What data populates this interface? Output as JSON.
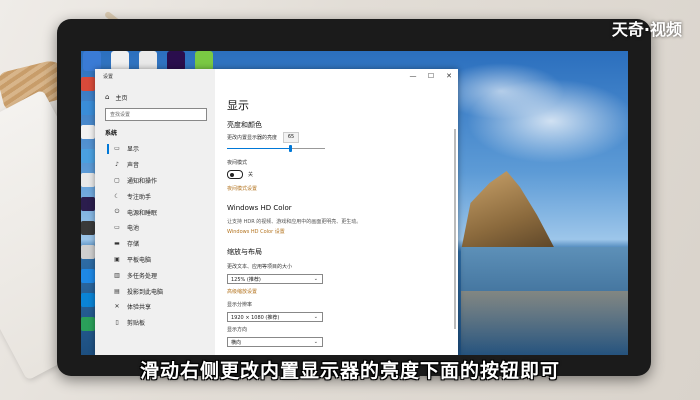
{
  "watermark": "天奇·视频",
  "subtitle": "滑动右侧更改内置显示器的亮度下面的按钮即可",
  "window": {
    "title": "设置",
    "minimize": "—",
    "maximize": "☐",
    "close": "✕"
  },
  "nav": {
    "home": "主页",
    "search_placeholder": "查找设置",
    "section": "系统",
    "items": [
      {
        "icon": "display-icon",
        "glyph": "▭",
        "label": "显示"
      },
      {
        "icon": "sound-icon",
        "glyph": "♪",
        "label": "声音"
      },
      {
        "icon": "notifications-icon",
        "glyph": "▢",
        "label": "通知和操作"
      },
      {
        "icon": "focus-assist-icon",
        "glyph": "☾",
        "label": "专注助手"
      },
      {
        "icon": "power-icon",
        "glyph": "⏻",
        "label": "电源和睡眠"
      },
      {
        "icon": "battery-icon",
        "glyph": "▭",
        "label": "电池"
      },
      {
        "icon": "storage-icon",
        "glyph": "▬",
        "label": "存储"
      },
      {
        "icon": "tablet-icon",
        "glyph": "▣",
        "label": "平板电脑"
      },
      {
        "icon": "multitasking-icon",
        "glyph": "▥",
        "label": "多任务处理"
      },
      {
        "icon": "projecting-icon",
        "glyph": "▤",
        "label": "投影到此电脑"
      },
      {
        "icon": "shared-experiences-icon",
        "glyph": "✕",
        "label": "体验共享"
      },
      {
        "icon": "clipboard-icon",
        "glyph": "▯",
        "label": "剪贴板"
      }
    ]
  },
  "content": {
    "heading": "显示",
    "brightness_section": "亮度和颜色",
    "brightness_label": "更改内置显示器的亮度",
    "brightness_value": "65",
    "night_light_label": "夜间模式",
    "night_light_state": "关",
    "night_light_link": "夜间模式设置",
    "hdr_heading": "Windows HD Color",
    "hdr_desc": "让支持 HDR 的视频、游戏和应用中的画面更明亮、更生动。",
    "hdr_link": "Windows HD Color 设置",
    "scale_heading": "缩放与布局",
    "scale_label": "更改文本、应用等项目的大小",
    "scale_value": "125% (推荐)",
    "scale_link": "高级缩放设置",
    "resolution_label": "显示分辨率",
    "resolution_value": "1920 × 1080 (推荐)",
    "orientation_label": "显示方向",
    "orientation_value": "横向"
  },
  "brightness_level": 0.65,
  "colors": {
    "accent": "#0078d7",
    "link": "#b3731e"
  }
}
